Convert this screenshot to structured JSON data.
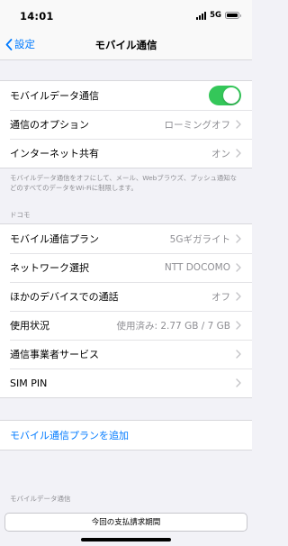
{
  "status_bar": {
    "time": "14:01",
    "network": "5G"
  },
  "nav": {
    "back_label": "設定",
    "title": "モバイル通信"
  },
  "group1": {
    "mobile_data": {
      "label": "モバイルデータ通信",
      "enabled": true
    },
    "options": {
      "label": "通信のオプション",
      "value": "ローミングオフ"
    },
    "hotspot": {
      "label": "インターネット共有",
      "value": "オン"
    }
  },
  "group1_footer": "モバイルデータ通信をオフにして、メール、Webブラウズ、プッシュ通知などのすべてのデータをWi-Fiに制限します。",
  "carrier_header": "ドコモ",
  "group2": {
    "plan": {
      "label": "モバイル通信プラン",
      "value": "5Gギガライト"
    },
    "network": {
      "label": "ネットワーク選択",
      "value": "NTT DOCOMO"
    },
    "other_devices": {
      "label": "ほかのデバイスでの通話",
      "value": "オフ"
    },
    "usage": {
      "label": "使用状況",
      "value": "使用済み: 2.77 GB / 7 GB"
    },
    "carrier_services": {
      "label": "通信事業者サービス"
    },
    "sim_pin": {
      "label": "SIM PIN"
    }
  },
  "add_plan": {
    "label": "モバイル通信プランを追加"
  },
  "mobile_data_header": "モバイルデータ通信",
  "billing": {
    "label": "今回の支払請求期間"
  },
  "colors": {
    "accent": "#007aff",
    "toggle_on": "#34c759",
    "background": "#f2f2f7"
  }
}
